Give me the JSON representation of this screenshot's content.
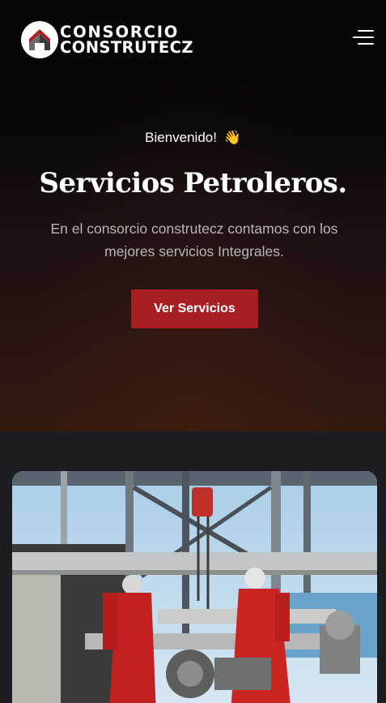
{
  "header": {
    "logo": {
      "line1": "CONSORCIO",
      "line2": "CONSTRUTECZ",
      "icon": "company-logo-icon"
    },
    "menu_icon": "hamburger-menu-icon"
  },
  "hero": {
    "welcome": "Bienvenido!",
    "welcome_emoji": "👋",
    "title": "Servicios Petroleros.",
    "description": "En el consorcio construtecz contamos con los mejores servicios Integrales.",
    "cta_label": "Ver Servicios"
  },
  "colors": {
    "accent": "#a91e22",
    "page_background": "#1c1d23",
    "hero_top": "#060507",
    "hero_bottom": "#331a0f",
    "description_text": "#b9b6b6"
  }
}
